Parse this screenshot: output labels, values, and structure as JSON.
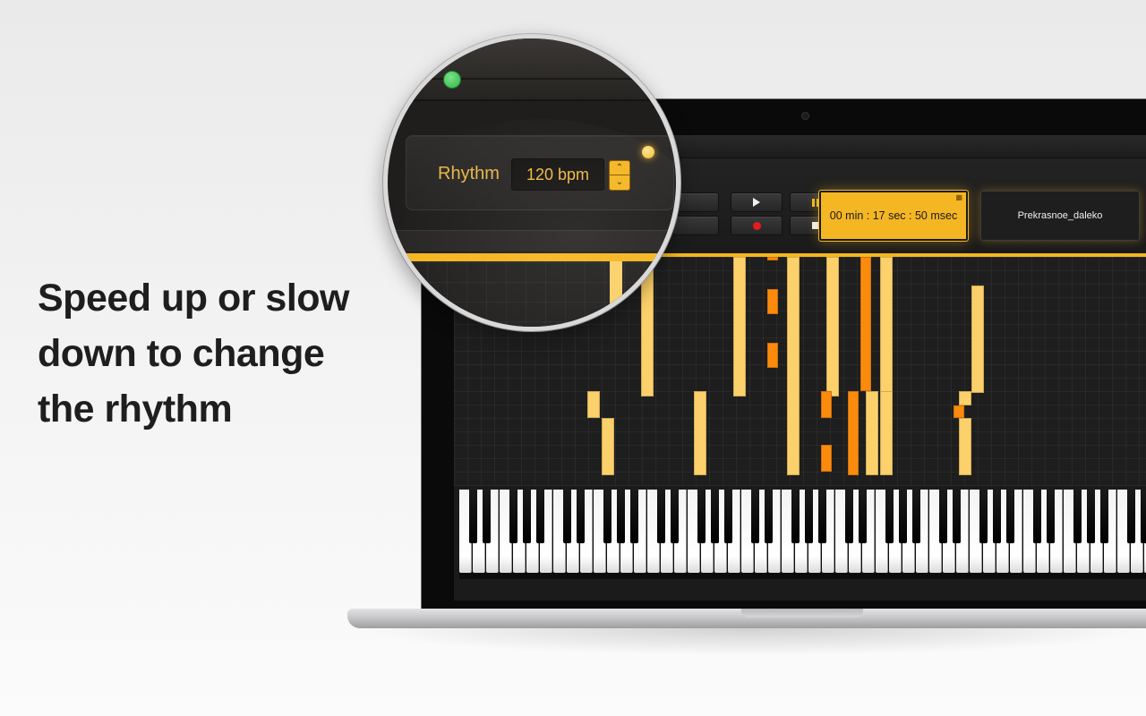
{
  "headline": {
    "line1": "Speed up or slow",
    "line2": "down to change",
    "line3": "the rhythm"
  },
  "magnifier": {
    "rhythm_label": "Rhythm",
    "bpm_value": "120 bpm"
  },
  "player": {
    "timer": "00 min : 17 sec : 50  msec",
    "song_name": "Prekrasnoe_daleko"
  },
  "colors": {
    "accent": "#f5b61f",
    "note_light": "#fcd06a",
    "note_dark": "#fb8a0d",
    "record": "#e41c1c",
    "led_green": "#2fb447"
  },
  "icons": {
    "play": "play-icon",
    "pause": "pause-icon",
    "record": "record-icon",
    "stop": "stop-icon",
    "stepper": "chevron-up-down-icon",
    "timer_badge": "timer-icon"
  }
}
